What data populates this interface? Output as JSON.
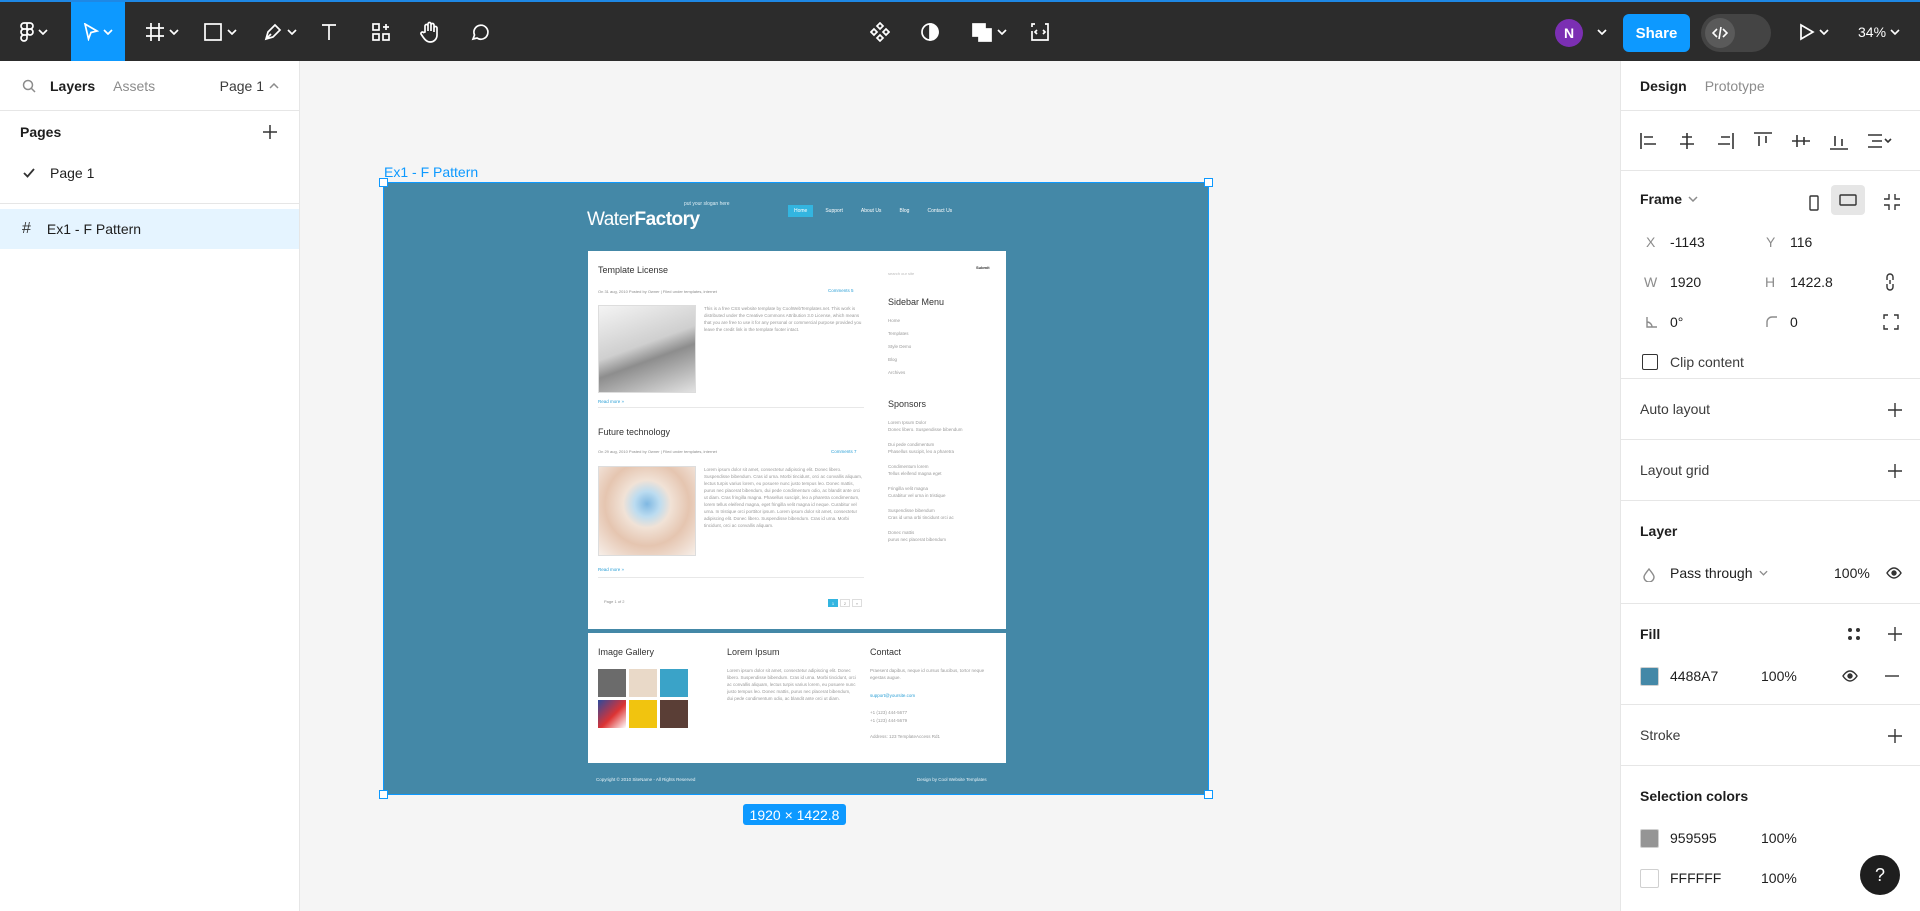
{
  "toolbar": {
    "share_label": "Share",
    "avatar_initial": "N",
    "zoom": "34%",
    "tools": [
      "main-menu",
      "move",
      "frame",
      "shape",
      "pen",
      "text",
      "resources",
      "hand",
      "comment"
    ],
    "center_tools": [
      "component",
      "contrast",
      "boolean",
      "dev-code"
    ]
  },
  "left_panel": {
    "tabs": {
      "layers": "Layers",
      "assets": "Assets"
    },
    "page_selector": "Page 1",
    "pages_heading": "Pages",
    "pages": [
      {
        "label": "Page 1",
        "selected": true
      }
    ],
    "layers": [
      {
        "label": "Ex1 - F Pattern",
        "icon": "frame-icon"
      }
    ]
  },
  "canvas": {
    "frame_label": "Ex1 - F Pattern",
    "frame_fill": "#4488a7",
    "size_badge": "1920 × 1422.8",
    "site": {
      "logo_light": "Water",
      "logo_bold": "Factory",
      "slogan": "put your slogan here",
      "nav": [
        "Home",
        "Support",
        "About Us",
        "Blog",
        "Contact Us"
      ],
      "search_placeholder": "search our site",
      "submit": "Submit",
      "post1": {
        "title": "Template License",
        "meta": "On 31 aug, 2010 Posted by Owner  |  Filed under templates, internet",
        "comments": "Comments 5",
        "text": "This is a free CSS website template by CoolWebTemplates.net. This work is distributed under the Creative Commons Attribution 3.0 License, which means that you are free to use it for any personal or commercial purpose provided you leave the credit link in the template footer intact.",
        "read_more": "Read more »"
      },
      "post2": {
        "title": "Future technology",
        "meta": "On 29 aug, 2010 Posted by Owner  |  Filed under templates, internet",
        "comments": "Comments 7",
        "text": "Lorem ipsum dolor sit amet, consectetur adipiscing elit. Donec libero. Suspendisse bibendum. Cras id urna. Morbi tincidunt, orci ac convallis aliquam, lectus turpis varius lorem, eu posuere nunc justo tempus leo. Donec mattis, purus nec placerat bibendum, dui pede condimentum odio, ac blandit ante orci ut diam. Cras fringilla magna. Phasellus suscipit, leo a pharetra condimentum, lorem tellus eleifend magna, eget fringilla velit magna id neque. Curabitur vel urna. In tristique orci porttitor ipsum. Lorem ipsum dolor sit amet, consectetur adipiscing elit. Donec libero. Suspendisse bibendum. Cras id urna. Morbi tincidunt, orci ac convallis aliquam.",
        "read_more": "Read more »"
      },
      "pagination": {
        "label": "Page 1 of 2",
        "pages": [
          "1",
          "2",
          "»"
        ]
      },
      "sidebar": {
        "menu_title": "Sidebar Menu",
        "menu_items": [
          "Home",
          "Templates",
          "Style Demo",
          "Blog",
          "Archives"
        ],
        "sponsors_title": "Sponsors",
        "sponsors": [
          [
            "Lorem Ipsum Dolor",
            "Donec libero. Suspendisse bibendum"
          ],
          [
            "Dui pede condimentum",
            "Phasellus suscipit, leo a pharetra"
          ],
          [
            "Condimentum lorem",
            "Tellus eleifend magna eget"
          ],
          [
            "Fringilla velit magna",
            "Curabitur vel urna in tristique"
          ],
          [
            "Suspendisse bibendum",
            "Cras id urna orbi tincidunt orci ac"
          ],
          [
            "Donec mattis",
            "purus nec placerat bibendum"
          ]
        ]
      },
      "footer": {
        "gallery_title": "Image Gallery",
        "lorem_title": "Lorem Ipsum",
        "lorem_text": "Lorem ipsum dolor sit amet, consectetur adipiscing elit. Donec libero. Suspendisse bibendum. Cras id urna. Morbi tincidunt, orci ac convallis aliquam, lectus turpis varius lorem, eu posuere nunc justo tempus leo. Donec mattis, purus nec placerat bibendum, dui pede condimentum odio, ac blandit ante orci ut diam.",
        "contact_title": "Contact",
        "contact_text": "Praesent dapibus, neque id cursus faucibus, tortor neque egestas augue.",
        "contact_email": "support@yoursite.com",
        "contact_phone1": "+1 (123) 444-5677",
        "contact_phone2": "+1 (123) 444-5679",
        "contact_address": "Address: 123 TemplateAccess Rd1"
      },
      "copyright": "Copyright © 2010 SiteName - All Rights Reserved",
      "design_credit": "Design by Cool Website Templates"
    }
  },
  "right_panel": {
    "tabs": {
      "design": "Design",
      "prototype": "Prototype"
    },
    "frame": {
      "title": "Frame",
      "x_label": "X",
      "x": "-1143",
      "y_label": "Y",
      "y": "116",
      "w_label": "W",
      "w": "1920",
      "h_label": "H",
      "h": "1422.8",
      "rotation": "0°",
      "radius": "0",
      "clip_label": "Clip content"
    },
    "auto_layout": "Auto layout",
    "layout_grid": "Layout grid",
    "layer": {
      "title": "Layer",
      "blend": "Pass through",
      "opacity": "100%"
    },
    "fill": {
      "title": "Fill",
      "hex": "4488A7",
      "opacity": "100%",
      "color": "#4488a7"
    },
    "stroke": "Stroke",
    "selection_colors": {
      "title": "Selection colors",
      "items": [
        {
          "hex": "959595",
          "opacity": "100%",
          "color": "#959595"
        },
        {
          "hex": "FFFFFF",
          "opacity": "100%",
          "color": "#ffffff"
        }
      ]
    },
    "help": "?"
  }
}
